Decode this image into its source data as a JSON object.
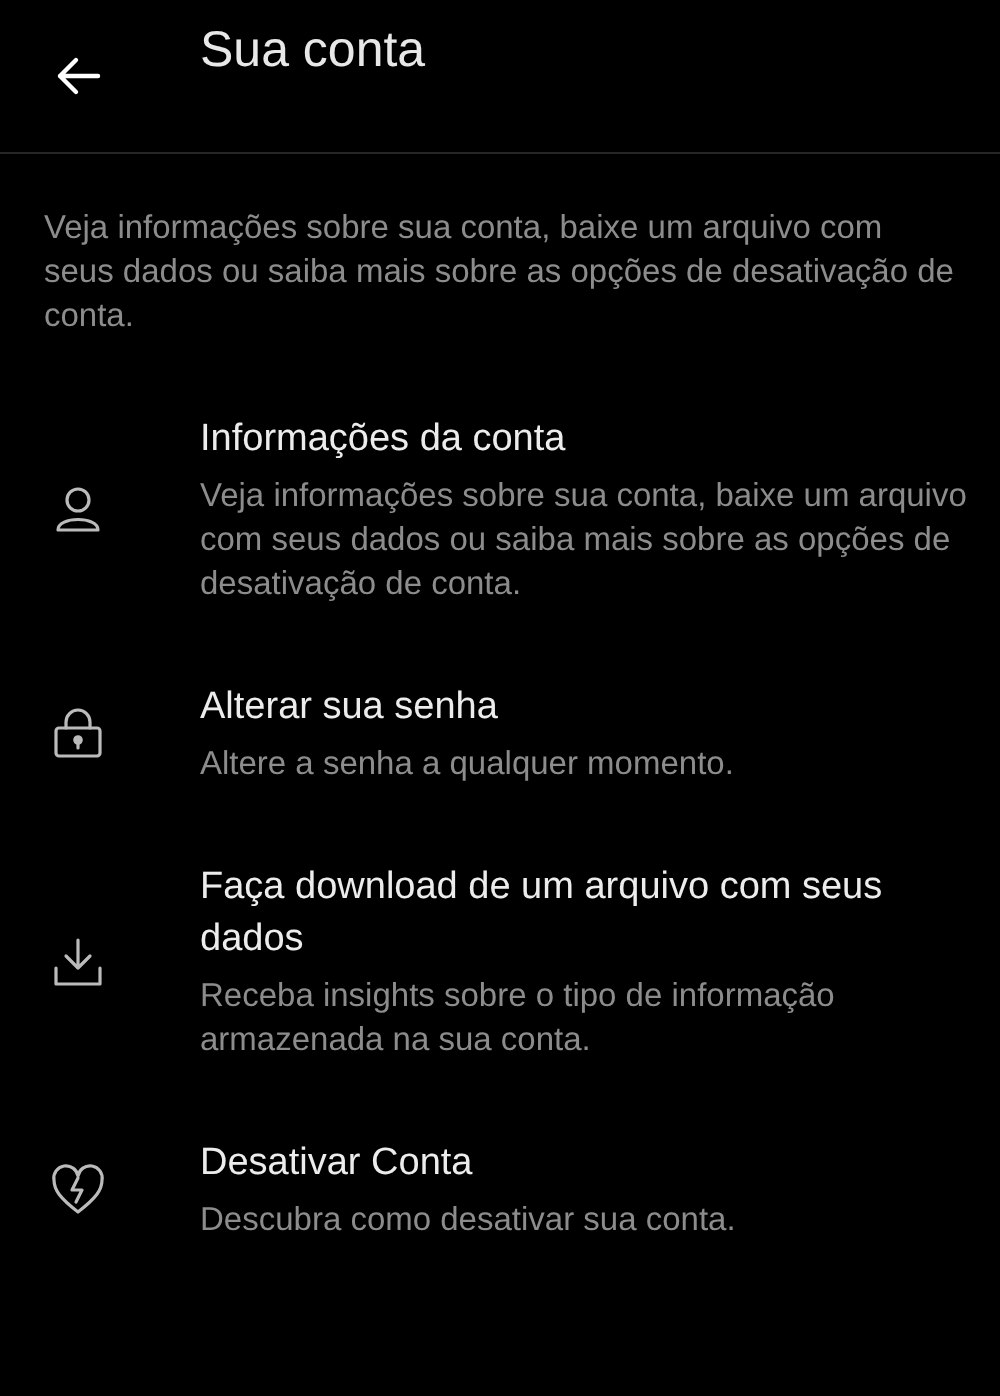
{
  "header": {
    "title": "Sua conta"
  },
  "intro": "Veja informações sobre sua conta, baixe um arquivo com seus dados ou saiba mais sobre as opções de desativação de conta.",
  "items": [
    {
      "kind": "person",
      "title": "Informações da conta",
      "description": "Veja informações sobre sua conta, baixe um arquivo com seus dados ou saiba mais sobre as opções de desativação de conta."
    },
    {
      "kind": "lock",
      "title": "Alterar sua senha",
      "description": "Altere a senha a qualquer momento."
    },
    {
      "kind": "download",
      "title": "Faça download de um arquivo com seus dados",
      "description": "Receba insights sobre o tipo de informação armazenada na sua conta."
    },
    {
      "kind": "heart",
      "title": "Desativar Conta",
      "description": "Descubra como desativar sua conta."
    }
  ]
}
